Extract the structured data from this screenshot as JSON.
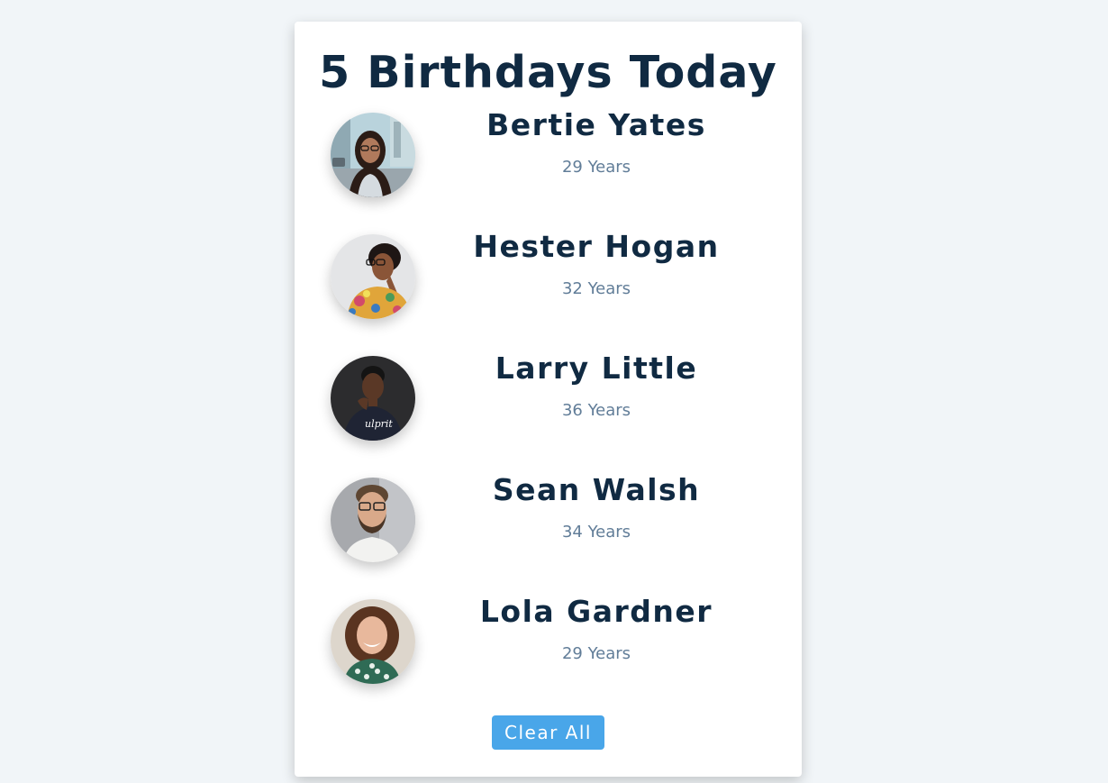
{
  "title": "5 Birthdays Today",
  "people": [
    {
      "name": "Bertie Yates",
      "age": "29 Years",
      "avatar_icon": "avatar-woman-glasses-street"
    },
    {
      "name": "Hester Hogan",
      "age": "32 Years",
      "avatar_icon": "avatar-woman-glasses-floral"
    },
    {
      "name": "Larry Little",
      "age": "36 Years",
      "avatar_icon": "avatar-man-dark-shirt"
    },
    {
      "name": "Sean Walsh",
      "age": "34 Years",
      "avatar_icon": "avatar-man-glasses-beard"
    },
    {
      "name": "Lola Gardner",
      "age": "29 Years",
      "avatar_icon": "avatar-woman-curly-hair"
    }
  ],
  "clear_button_label": "Clear All",
  "colors": {
    "background": "#f1f5f8",
    "card": "#ffffff",
    "heading": "#102a42",
    "age_text": "#617d98",
    "button": "#49a6e9"
  }
}
